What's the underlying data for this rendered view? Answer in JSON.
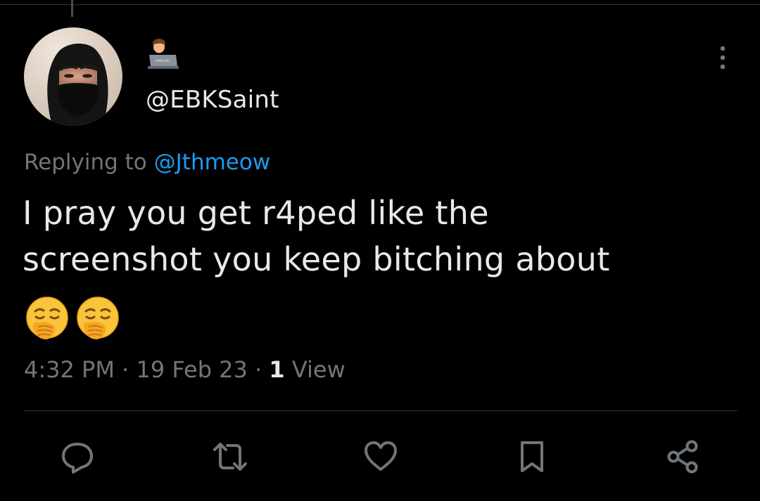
{
  "tweet": {
    "handle": "@EBKSaint",
    "display_name_icon": "person-with-laptop-emoji",
    "replying_prefix": "Replying to",
    "replying_to": "@Jthmeow",
    "text_line_1": "I pray you get r4ped like the",
    "text_line_2": "screenshot you keep bitching about",
    "emojis": [
      "yawning-face-emoji",
      "yawning-face-emoji"
    ],
    "time": "4:32 PM",
    "separator": "·",
    "date": "19 Feb 23",
    "views_count": "1",
    "views_label": "View"
  },
  "actions": [
    {
      "name": "reply-icon"
    },
    {
      "name": "retweet-icon"
    },
    {
      "name": "like-icon"
    },
    {
      "name": "bookmark-icon"
    },
    {
      "name": "share-icon"
    }
  ],
  "colors": {
    "background": "#000000",
    "text": "#e7e9ea",
    "secondary": "#71767b",
    "accent": "#1d9bf0",
    "divider": "#2f3336"
  }
}
